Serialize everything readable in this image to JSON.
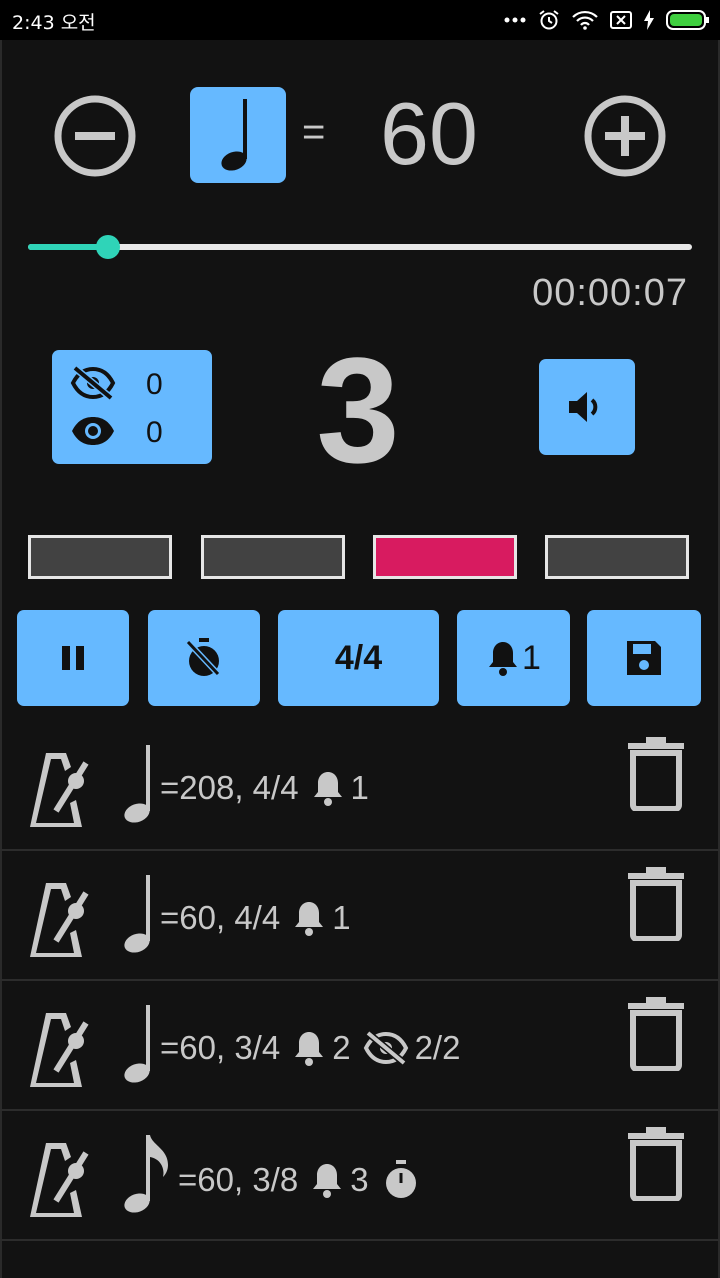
{
  "status_bar": {
    "time": "2:43 오전",
    "icons": [
      "dots-icon",
      "alarm-icon",
      "wifi-icon",
      "sim-icon",
      "charging-icon",
      "battery-icon"
    ]
  },
  "tempo": {
    "note_icon": "quarter-note-icon",
    "equals": "=",
    "bpm": "60",
    "decrease_icon": "minus-circle-icon",
    "increase_icon": "plus-circle-icon"
  },
  "slider": {
    "value_fraction": 0.12
  },
  "elapsed_time": "00:00:07",
  "visibility": {
    "hidden_count": "0",
    "visible_count": "0"
  },
  "current_beat": "3",
  "beats": {
    "count": 4,
    "active_index": 2,
    "colors": {
      "inactive": "#424242",
      "active": "#d81b60"
    }
  },
  "controls": {
    "pause_icon": "pause-icon",
    "timer_off_icon": "timer-off-icon",
    "time_signature": "4/4",
    "bell_count": "1",
    "save_icon": "save-icon"
  },
  "presets": [
    {
      "note": "quarter",
      "tempo_sig": "=208, 4/4",
      "bell": "1",
      "hidden": "",
      "timer": false
    },
    {
      "note": "quarter",
      "tempo_sig": "=60, 4/4",
      "bell": "1",
      "hidden": "",
      "timer": false
    },
    {
      "note": "quarter",
      "tempo_sig": "=60, 3/4",
      "bell": "2",
      "hidden": "2/2",
      "timer": false
    },
    {
      "note": "eighth",
      "tempo_sig": "=60, 3/8",
      "bell": "3",
      "hidden": "",
      "timer": true
    }
  ],
  "colors": {
    "accent": "#66b9ff",
    "thumb": "#2fd4b8",
    "active_beat": "#d81b60",
    "background": "#121212",
    "text": "#c8c8c8"
  }
}
